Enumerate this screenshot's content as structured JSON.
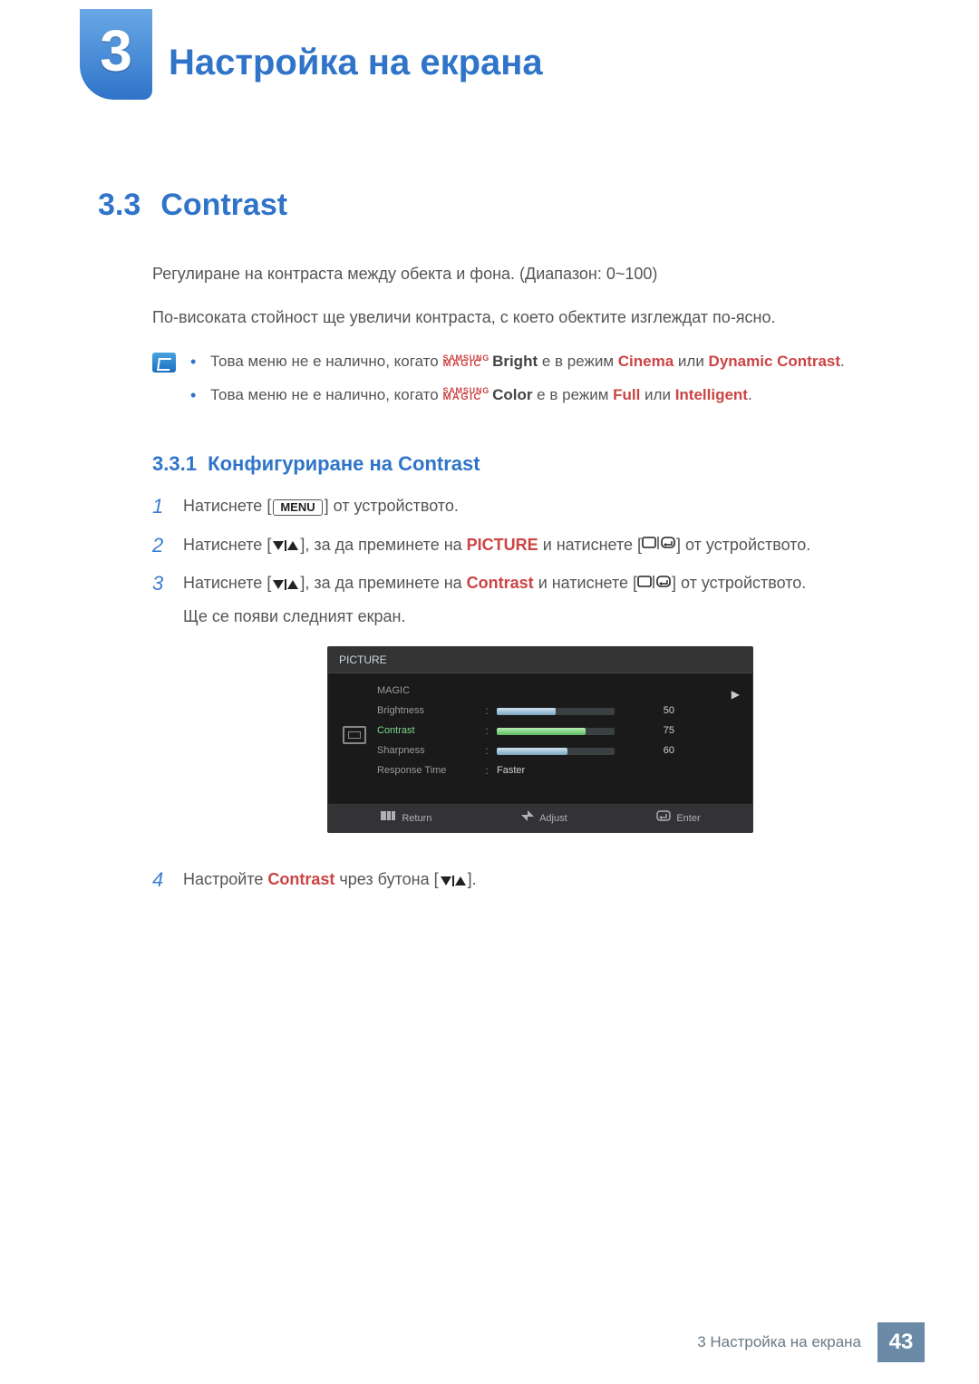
{
  "chapter": {
    "number": "3",
    "title": "Настройка на екрана"
  },
  "h2": {
    "num": "3.3",
    "title": "Contrast"
  },
  "para1": "Регулиране на контраста между обекта и фона. (Диапазон: 0~100)",
  "para2": "По-високата стойност ще увеличи контраста, с което обектите изглеждат по-ясно.",
  "note": {
    "bullets": [
      {
        "pre": "Това меню не е налично, когато ",
        "magic_samsung": "SAMSUNG",
        "magic_magic": "MAGIC",
        "magic_suffix": "Bright",
        "mid": " е в режим ",
        "w1": "Cinema",
        "sep": " или ",
        "w2": "Dynamic Contrast",
        "end": "."
      },
      {
        "pre": "Това меню не е налично, когато ",
        "magic_samsung": "SAMSUNG",
        "magic_magic": "MAGIC",
        "magic_suffix": "Color",
        "mid": " е в режим ",
        "w1": "Full",
        "sep": " или ",
        "w2": "Intelligent",
        "end": "."
      }
    ]
  },
  "h3": {
    "num": "3.3.1",
    "title": "Конфигуриране на Contrast"
  },
  "steps": {
    "s1": {
      "n": "1",
      "pre": "Натиснете [",
      "menu": "MENU",
      "post": "] от устройството."
    },
    "s2": {
      "n": "2",
      "pre": "Натиснете [",
      "mid1": "], за да преминете на ",
      "word": "PICTURE",
      "mid2": " и натиснете [",
      "post": "] от устройството."
    },
    "s3": {
      "n": "3",
      "pre": "Натиснете [",
      "mid1": "], за да преминете на ",
      "word": "Contrast",
      "mid2": " и натиснете [",
      "post": "] от устройството.",
      "extra": "Ще се появи следният екран."
    },
    "s4": {
      "n": "4",
      "pre": "Настройте ",
      "word": "Contrast",
      "mid": " чрез бутона [",
      "post": "]."
    }
  },
  "osd": {
    "title": "PICTURE",
    "rows": {
      "magic": "MAGIC",
      "brightness": {
        "label": "Brightness",
        "value": "50",
        "fill": 50
      },
      "contrast": {
        "label": "Contrast",
        "value": "75",
        "fill": 75
      },
      "sharpness": {
        "label": "Sharpness",
        "value": "60",
        "fill": 60
      },
      "response": {
        "label": "Response Time",
        "value": "Faster"
      }
    },
    "footer": {
      "return": "Return",
      "adjust": "Adjust",
      "enter": "Enter"
    }
  },
  "footer": {
    "text": "3 Настройка на екрана",
    "page": "43"
  }
}
